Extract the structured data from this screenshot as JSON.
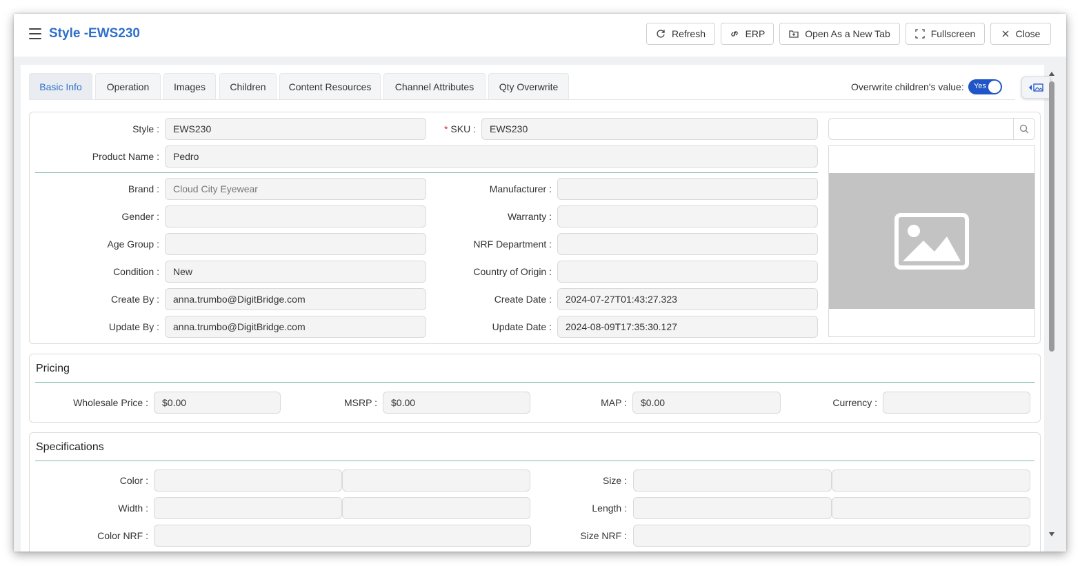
{
  "header": {
    "title": "Style -EWS230",
    "buttons": {
      "refresh": "Refresh",
      "erp": "ERP",
      "open_new_tab": "Open As a New Tab",
      "fullscreen": "Fullscreen",
      "close": "Close"
    }
  },
  "tabs": [
    {
      "label": "Basic Info",
      "active": true
    },
    {
      "label": "Operation"
    },
    {
      "label": "Images"
    },
    {
      "label": "Children"
    },
    {
      "label": "Content Resources"
    },
    {
      "label": "Channel Attributes"
    },
    {
      "label": "Qty Overwrite"
    }
  ],
  "overwrite": {
    "label": "Overwrite children's value:",
    "toggle_text": "Yes",
    "enabled": true
  },
  "basic": {
    "style": {
      "label": "Style :",
      "value": "EWS230"
    },
    "sku": {
      "label": "SKU :",
      "value": "EWS230",
      "required": true
    },
    "product_name": {
      "label": "Product Name :",
      "value": "Pedro"
    },
    "brand": {
      "label": "Brand :",
      "value": "Cloud City Eyewear"
    },
    "manufacturer": {
      "label": "Manufacturer :",
      "value": ""
    },
    "gender": {
      "label": "Gender :",
      "value": ""
    },
    "warranty": {
      "label": "Warranty :",
      "value": ""
    },
    "age_group": {
      "label": "Age Group :",
      "value": ""
    },
    "nrf_department": {
      "label": "NRF Department :",
      "value": ""
    },
    "condition": {
      "label": "Condition :",
      "value": "New"
    },
    "country_of_origin": {
      "label": "Country of Origin :",
      "value": ""
    },
    "create_by": {
      "label": "Create By :",
      "value": "anna.trumbo@DigitBridge.com"
    },
    "create_date": {
      "label": "Create Date :",
      "value": "2024-07-27T01:43:27.323"
    },
    "update_by": {
      "label": "Update By :",
      "value": "anna.trumbo@DigitBridge.com"
    },
    "update_date": {
      "label": "Update Date :",
      "value": "2024-08-09T17:35:30.127"
    },
    "image_search_value": ""
  },
  "pricing": {
    "title": "Pricing",
    "wholesale_price": {
      "label": "Wholesale Price :",
      "value": "$0.00"
    },
    "msrp": {
      "label": "MSRP :",
      "value": "$0.00"
    },
    "map": {
      "label": "MAP :",
      "value": "$0.00"
    },
    "currency": {
      "label": "Currency :",
      "value": ""
    }
  },
  "specifications": {
    "title": "Specifications",
    "color": {
      "label": "Color :",
      "value_1": "",
      "value_2": ""
    },
    "size": {
      "label": "Size :",
      "value_1": "",
      "value_2": ""
    },
    "width": {
      "label": "Width :",
      "value_1": "",
      "value_2": ""
    },
    "length": {
      "label": "Length :",
      "value_1": "",
      "value_2": ""
    },
    "color_nrf": {
      "label": "Color NRF :",
      "value": ""
    },
    "size_nrf": {
      "label": "Size NRF :",
      "value": ""
    }
  },
  "colors": {
    "accent": "#2f6fc9",
    "toggle": "#1f55c6",
    "divider": "#7ab8ad",
    "required": "#d32f2f"
  }
}
